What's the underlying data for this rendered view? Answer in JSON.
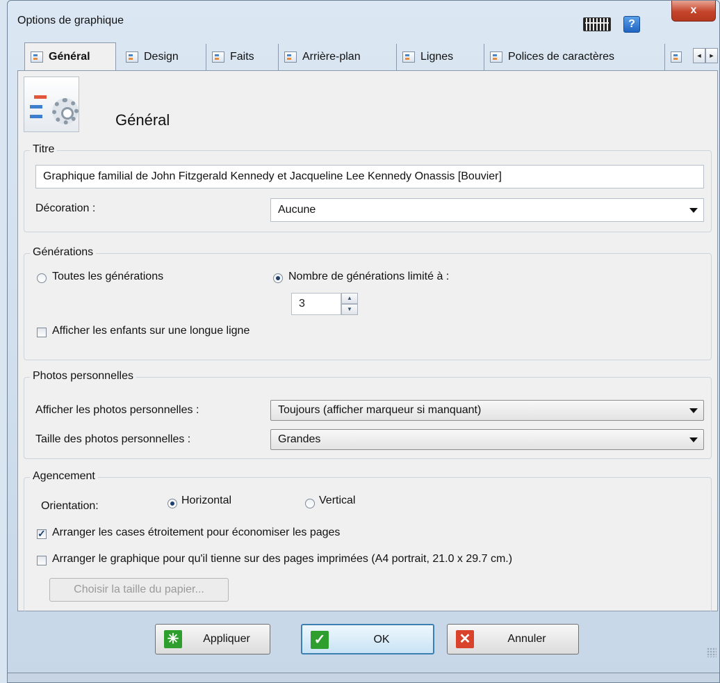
{
  "window": {
    "title": "Options de graphique",
    "close_label": "x",
    "help_label": "?"
  },
  "tabs": [
    {
      "label": "Général"
    },
    {
      "label": "Design"
    },
    {
      "label": "Faits"
    },
    {
      "label": "Arrière-plan"
    },
    {
      "label": "Lignes"
    },
    {
      "label": "Polices de caractères"
    }
  ],
  "tab_scroll": {
    "left": "◄",
    "right": "►"
  },
  "page": {
    "title": "Général"
  },
  "titre": {
    "legend": "Titre",
    "value": "Graphique familial de John Fitzgerald Kennedy et Jacqueline Lee Kennedy Onassis [Bouvier]",
    "decoration_label": "Décoration :",
    "decoration_value": "Aucune"
  },
  "generations": {
    "legend": "Générations",
    "all_label": "Toutes les générations",
    "limited_label": "Nombre de générations limité à :",
    "selected": "limited",
    "count": "3",
    "spin_up": "▲",
    "spin_down": "▼",
    "long_line_label": "Afficher les enfants sur une longue ligne",
    "long_line_checked": false
  },
  "photos": {
    "legend": "Photos personnelles",
    "show_label": "Afficher les photos personnelles :",
    "show_value": "Toujours (afficher marqueur si manquant)",
    "size_label": "Taille des photos personnelles :",
    "size_value": "Grandes"
  },
  "agencement": {
    "legend": "Agencement",
    "orientation_label": "Orientation:",
    "horizontal_label": "Horizontal",
    "vertical_label": "Vertical",
    "orientation_selected": "horizontal",
    "compact_label": "Arranger les cases étroitement pour économiser les pages",
    "compact_checked": true,
    "fit_pages_label": "Arranger le graphique pour qu'il tienne sur des pages imprimées (A4 portrait, 21.0 x 29.7 cm.)",
    "fit_pages_checked": false,
    "paper_button": "Choisir la taille du papier..."
  },
  "footer": {
    "apply": "Appliquer",
    "ok": "OK",
    "cancel": "Annuler",
    "apply_icon": "✳",
    "ok_icon": "✓",
    "cancel_icon": "✕"
  },
  "colors": {
    "ok_icon": "#2e9e2e",
    "cancel_icon": "#d9432b",
    "apply_icon": "#2e9e2e"
  }
}
